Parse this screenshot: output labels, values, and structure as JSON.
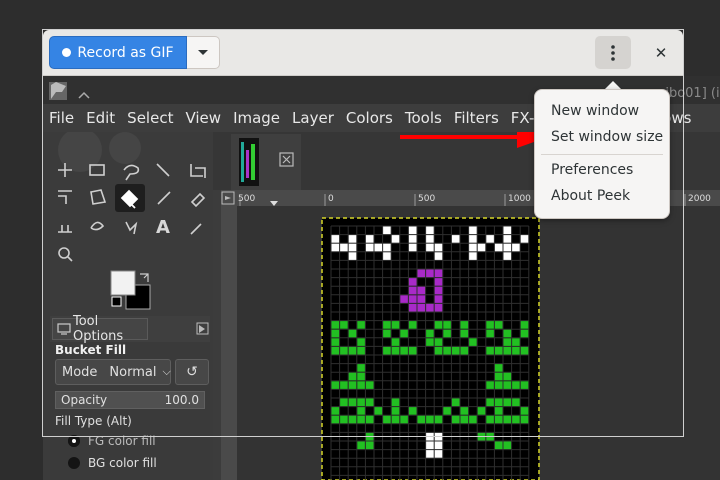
{
  "gimp": {
    "title_partial": "ribo01] (i",
    "menubar": [
      "File",
      "Edit",
      "Select",
      "View",
      "Image",
      "Layer",
      "Colors",
      "Tools",
      "Filters",
      "FX-Fou",
      "ndows"
    ],
    "tool_options": {
      "tab_label": "Tool Options",
      "title": "Bucket Fill",
      "mode_label": "Mode",
      "mode_value": "Normal",
      "opacity_label": "Opacity",
      "opacity_value": "100.0",
      "fill_type_label": "Fill Type  (Alt)",
      "fill_options": [
        "FG color fill",
        "BG color fill"
      ]
    },
    "ruler_labels": [
      "500",
      "0",
      "500",
      "1000",
      "2000"
    ]
  },
  "peek": {
    "record_label": "Record as GIF",
    "menu": {
      "items": [
        "New window",
        "Set window size",
        "Preferences",
        "About Peek"
      ]
    }
  },
  "colors": {
    "accent": "#3584e4",
    "arrow": "#ff0000",
    "gimp_bg": "#3d3d3d"
  }
}
